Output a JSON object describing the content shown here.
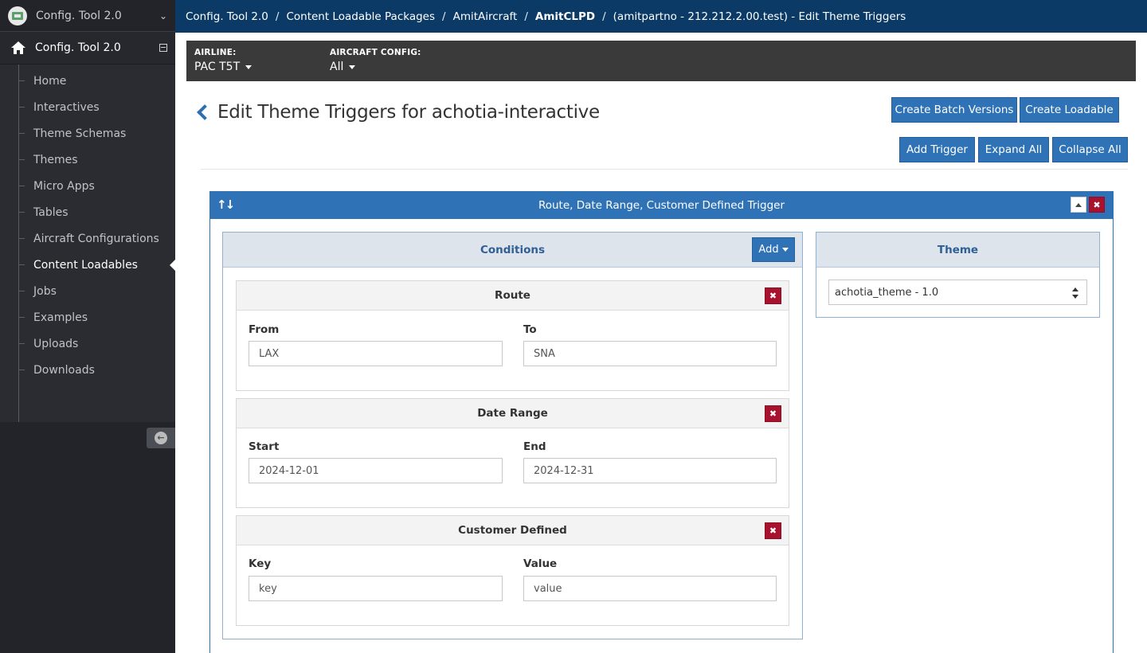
{
  "sidebar": {
    "app_name": "Config. Tool 2.0",
    "section_title": "Config. Tool 2.0",
    "items": [
      {
        "label": "Home"
      },
      {
        "label": "Interactives"
      },
      {
        "label": "Theme Schemas"
      },
      {
        "label": "Themes"
      },
      {
        "label": "Micro Apps"
      },
      {
        "label": "Tables"
      },
      {
        "label": "Aircraft Configurations"
      },
      {
        "label": "Content Loadables",
        "active": true
      },
      {
        "label": "Jobs"
      },
      {
        "label": "Examples"
      },
      {
        "label": "Uploads"
      },
      {
        "label": "Downloads"
      }
    ]
  },
  "breadcrumb": {
    "items": [
      "Config. Tool 2.0",
      "Content Loadable Packages",
      "AmitAircraft",
      "AmitCLPD",
      "(amitpartno - 212.212.2.00.test) - Edit Theme Triggers"
    ],
    "separator": "/"
  },
  "filters": {
    "airline_label": "AIRLINE:",
    "airline_value": "PAC T5T",
    "aircraft_config_label": "AIRCRAFT CONFIG:",
    "aircraft_config_value": "All"
  },
  "page": {
    "title": "Edit Theme Triggers for achotia-interactive"
  },
  "toolbar": {
    "create_batch_versions": "Create Batch Versions",
    "create_loadable": "Create Loadable",
    "add_trigger": "Add Trigger",
    "expand_all": "Expand All",
    "collapse_all": "Collapse All"
  },
  "trigger": {
    "title": "Route, Date Range, Customer Defined Trigger",
    "conditions": {
      "title": "Conditions",
      "add_label": "Add",
      "route": {
        "title": "Route",
        "from_label": "From",
        "from_value": "LAX",
        "to_label": "To",
        "to_value": "SNA"
      },
      "date_range": {
        "title": "Date Range",
        "start_label": "Start",
        "start_value": "2024-12-01",
        "end_label": "End",
        "end_value": "2024-12-31"
      },
      "customer_defined": {
        "title": "Customer Defined",
        "key_label": "Key",
        "key_value": "key",
        "value_label": "Value",
        "value_value": "value"
      }
    },
    "theme": {
      "title": "Theme",
      "selected": "achotia_theme - 1.0"
    }
  },
  "colors": {
    "topbar": "#0b3a66",
    "primary": "#2f73b6",
    "danger": "#a8122e",
    "sidebar": "#222429"
  }
}
